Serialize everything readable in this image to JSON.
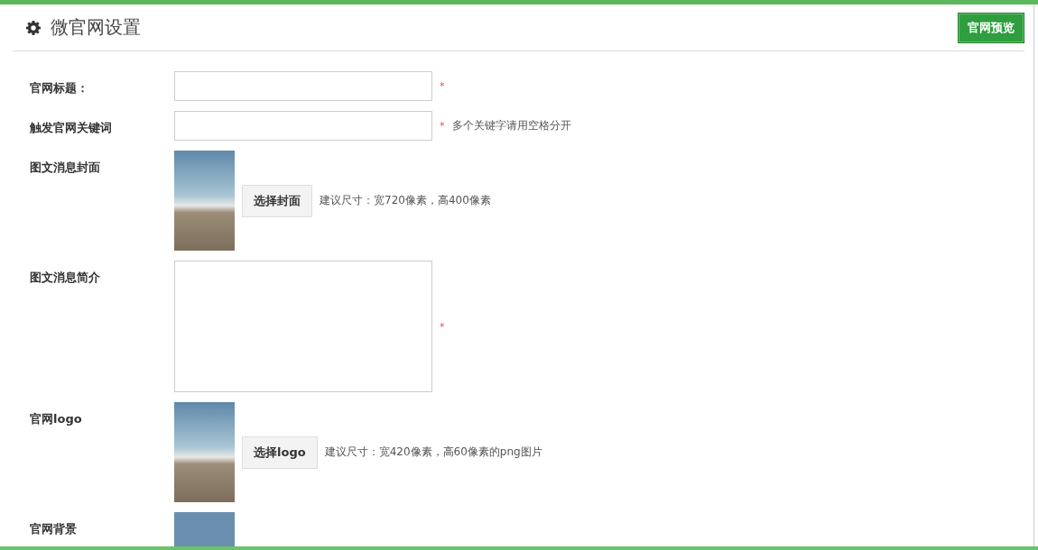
{
  "header": {
    "title": "微官网设置",
    "preview_button": "官网预览"
  },
  "fields": [
    {
      "kind": "input",
      "label": "官网标题：",
      "required": "*"
    },
    {
      "kind": "input",
      "label": "触发官网关键词",
      "required": "*",
      "hint": "多个关键字请用空格分开"
    },
    {
      "kind": "image-upload",
      "label": "图文消息封面",
      "button": "选择封面",
      "hint": "建议尺寸：宽720像素，高400像素"
    },
    {
      "kind": "textarea",
      "label": "图文消息简介",
      "required": "*"
    },
    {
      "kind": "image-upload",
      "label": "官网logo",
      "button": "选择logo",
      "hint": "建议尺寸：宽420像素，高60像素的png图片"
    },
    {
      "kind": "image",
      "label": "官网背景"
    }
  ]
}
